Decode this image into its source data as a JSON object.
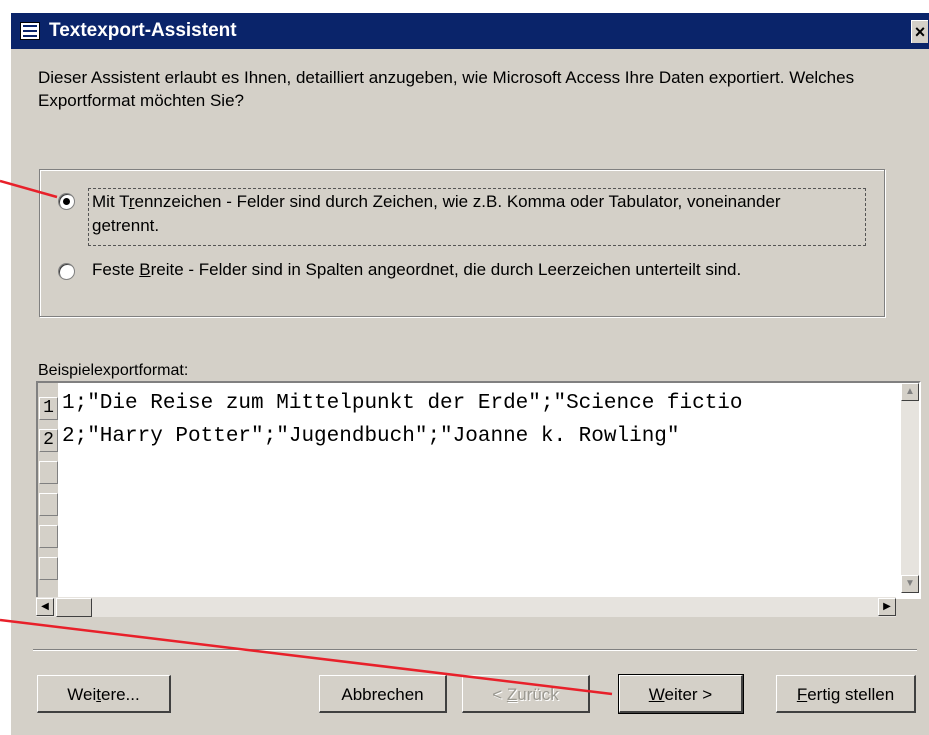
{
  "window": {
    "title": "Textexport-Assistent",
    "close_glyph": "×"
  },
  "intro": {
    "text": "Dieser Assistent erlaubt es Ihnen, detailliert anzugeben, wie Microsoft Access Ihre Daten exportiert.  Welches Exportformat möchten Sie?"
  },
  "format_options": [
    {
      "label_before": "Mit T",
      "label_hotkey": "r",
      "label_after": "ennzeichen - Felder sind durch Zeichen, wie z.B. Komma oder Tabulator, voneinander getrennt.",
      "selected": true
    },
    {
      "label_before": "Feste ",
      "label_hotkey": "B",
      "label_after": "reite - Felder sind in Spalten angeordnet, die durch Leerzeichen unterteilt sind.",
      "selected": false
    }
  ],
  "sample": {
    "label": "Beispielexportformat:",
    "row_numbers": [
      "1",
      "2"
    ],
    "lines": [
      "1;\"Die Reise zum Mittelpunkt der Erde\";\"Science fictio",
      "2;\"Harry Potter\";\"Jugendbuch\";\"Joanne k. Rowling\""
    ]
  },
  "buttons": {
    "advanced": {
      "before": "Wei",
      "hotkey": "t",
      "after": "ere..."
    },
    "cancel": {
      "label": "Abbrechen"
    },
    "back": {
      "before": "< ",
      "hotkey": "Z",
      "after": "urück"
    },
    "next": {
      "before": "",
      "hotkey": "W",
      "after": "eiter >"
    },
    "finish": {
      "before": "",
      "hotkey": "F",
      "after": "ertig stellen"
    }
  },
  "colors": {
    "titlebar": "#0a246a",
    "dialog": "#d4d0c8",
    "annotation_arrow": "#e8202a"
  },
  "icons": [
    "window-icon",
    "close-icon",
    "scroll-up-icon",
    "scroll-down-icon",
    "scroll-left-icon",
    "scroll-right-icon"
  ]
}
